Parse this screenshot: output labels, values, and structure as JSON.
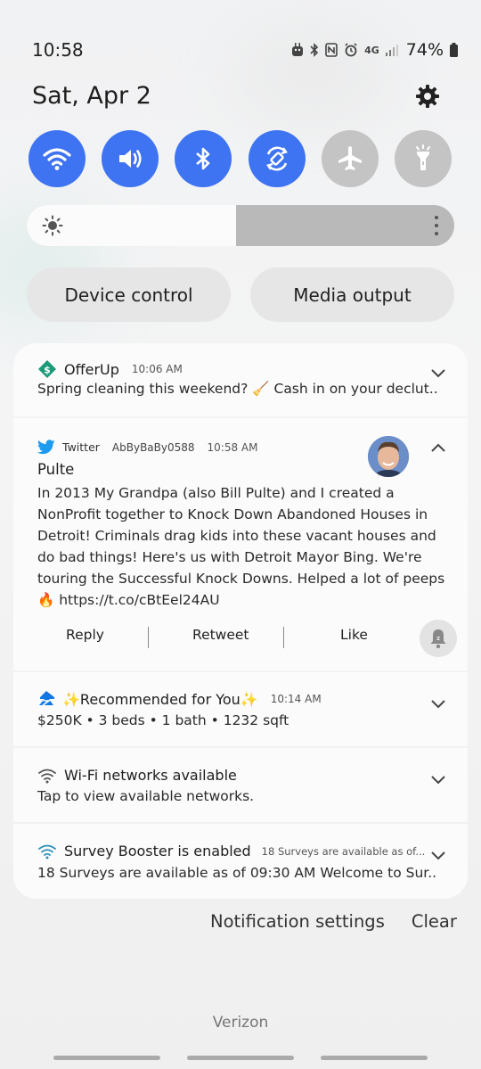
{
  "status_bar": {
    "time": "10:58",
    "network": "4G",
    "battery": "74%"
  },
  "header": {
    "date": "Sat, Apr 2"
  },
  "quick_settings": [
    {
      "name": "wifi",
      "on": true
    },
    {
      "name": "sound",
      "on": true
    },
    {
      "name": "bluetooth",
      "on": true
    },
    {
      "name": "auto-rotate",
      "on": true
    },
    {
      "name": "airplane-mode",
      "on": false
    },
    {
      "name": "flashlight",
      "on": false
    }
  ],
  "brightness": {
    "level": 0.49
  },
  "controls": {
    "device_control": "Device control",
    "media_output": "Media output"
  },
  "notifications": {
    "offerup": {
      "app": "OfferUp",
      "time": "10:06 AM",
      "text": "Spring cleaning this weekend? 🧹 Cash in on your declut.."
    },
    "twitter": {
      "app": "Twitter",
      "account": "AbByBaBy0588",
      "time": "10:58 AM",
      "title": "Pulte",
      "text": "In 2013 My Grandpa (also Bill Pulte) and I created a NonProfit together to Knock Down Abandoned Houses in Detroit! Criminals drag kids into these vacant houses and do bad things! Here's us with Detroit Mayor Bing. We're touring the Successful Knock Downs. Helped a lot of peeps 🔥 https://t.co/cBtEel24AU",
      "actions": {
        "reply": "Reply",
        "retweet": "Retweet",
        "like": "Like"
      }
    },
    "zillow": {
      "app": "✨Recommended for You✨",
      "time": "10:14 AM",
      "text": "$250K • 3 beds • 1 bath • 1232 sqft"
    },
    "wifi": {
      "app": "Wi-Fi networks available",
      "text": "Tap to view available networks."
    },
    "survey": {
      "app": "Survey Booster is enabled",
      "subtext": "18 Surveys are available as of...",
      "text": "18 Surveys are available as of 09:30 AM Welcome to Sur.."
    }
  },
  "footer": {
    "notification_settings": "Notification settings",
    "clear": "Clear",
    "carrier": "Verizon"
  }
}
